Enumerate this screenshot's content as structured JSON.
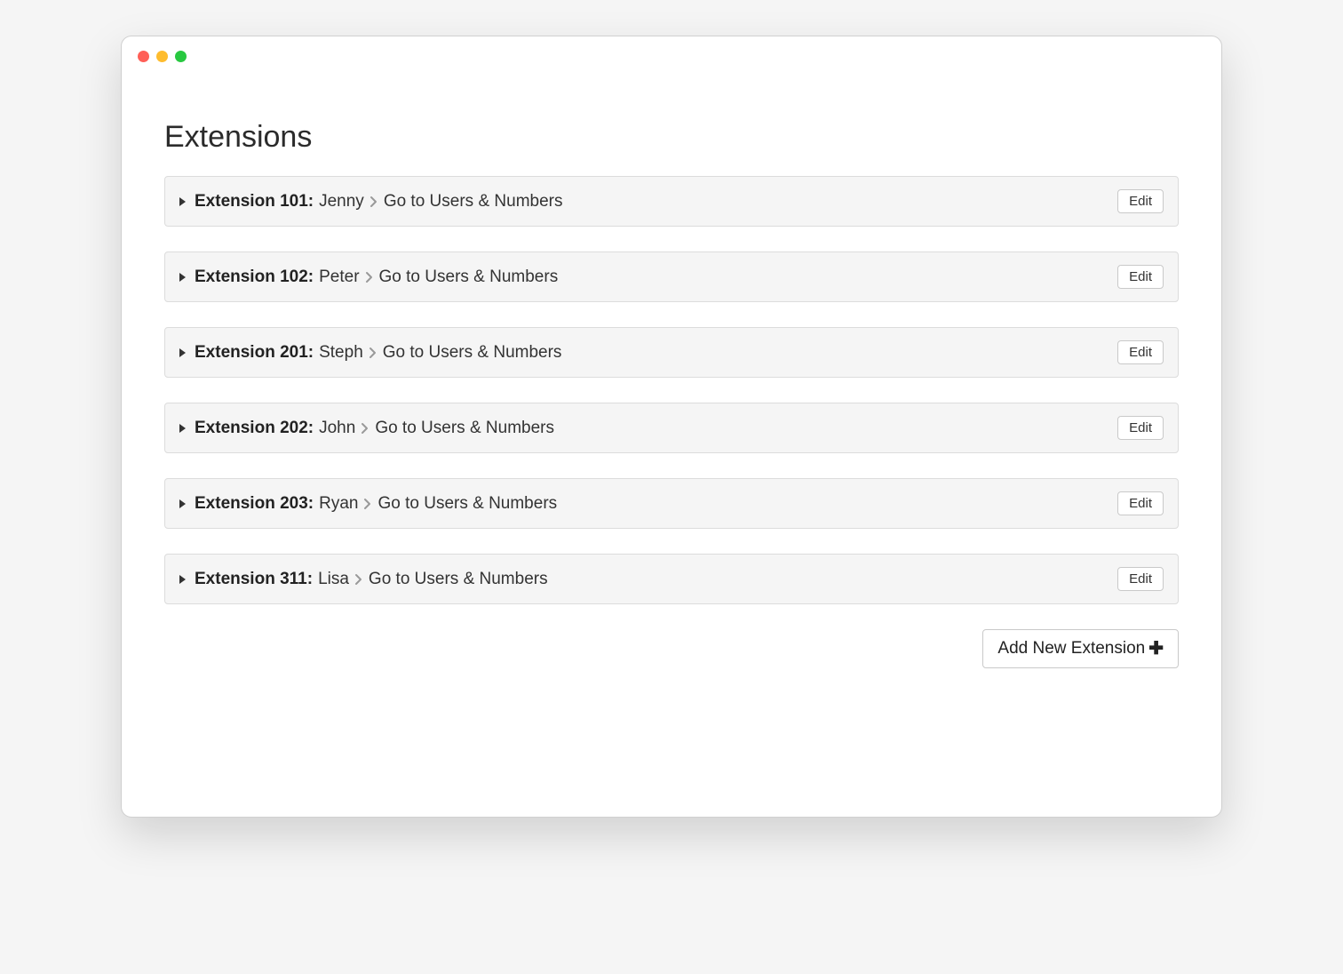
{
  "page": {
    "title": "Extensions"
  },
  "extensions": [
    {
      "label": "Extension 101:",
      "name": "Jenny",
      "link": "Go to Users & Numbers",
      "edit": "Edit"
    },
    {
      "label": "Extension 102:",
      "name": "Peter",
      "link": "Go to Users & Numbers",
      "edit": "Edit"
    },
    {
      "label": "Extension 201:",
      "name": "Steph",
      "link": "Go to Users & Numbers",
      "edit": "Edit"
    },
    {
      "label": "Extension 202:",
      "name": "John",
      "link": "Go to Users & Numbers",
      "edit": "Edit"
    },
    {
      "label": "Extension 203:",
      "name": "Ryan",
      "link": "Go to Users & Numbers",
      "edit": "Edit"
    },
    {
      "label": "Extension 311:",
      "name": "Lisa",
      "link": "Go to Users & Numbers",
      "edit": "Edit"
    }
  ],
  "buttons": {
    "add_new": "Add New Extension"
  }
}
